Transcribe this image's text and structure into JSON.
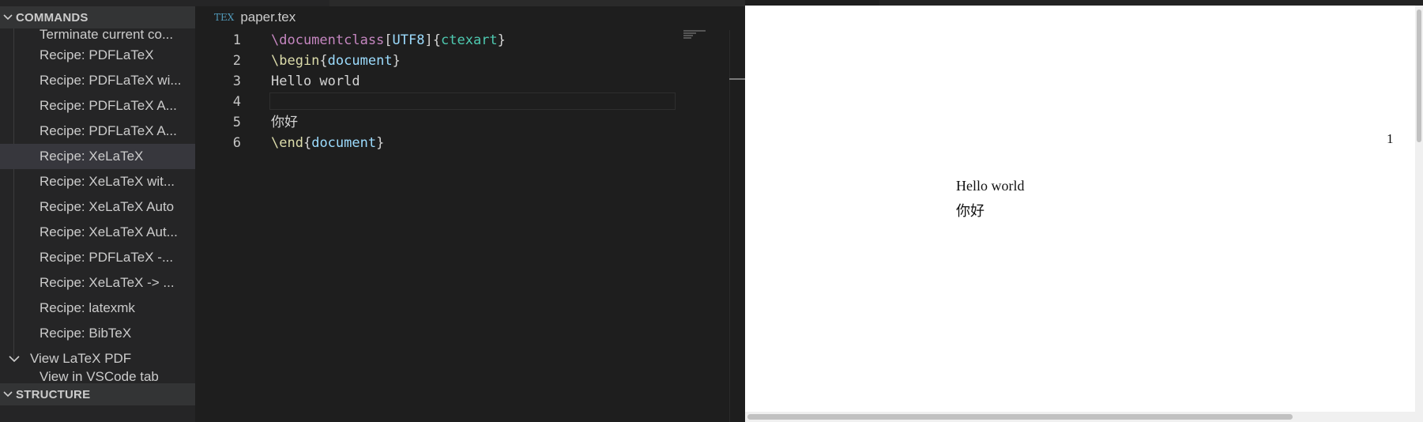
{
  "sidebar": {
    "commands_header": "COMMANDS",
    "structure_header": "STRUCTURE",
    "items": [
      {
        "label": "Terminate current co..."
      },
      {
        "label": "Recipe: PDFLaTeX"
      },
      {
        "label": "Recipe: PDFLaTeX wi..."
      },
      {
        "label": "Recipe: PDFLaTeX A..."
      },
      {
        "label": "Recipe: PDFLaTeX A..."
      },
      {
        "label": "Recipe: XeLaTeX"
      },
      {
        "label": "Recipe: XeLaTeX wit..."
      },
      {
        "label": "Recipe: XeLaTeX Auto"
      },
      {
        "label": "Recipe: XeLaTeX Aut..."
      },
      {
        "label": "Recipe: PDFLaTeX -..."
      },
      {
        "label": "Recipe: XeLaTeX -> ..."
      },
      {
        "label": "Recipe: latexmk"
      },
      {
        "label": "Recipe: BibTeX"
      }
    ],
    "group_label": "View LaTeX PDF",
    "cut_label": "View in VSCode tab"
  },
  "editor": {
    "tab": {
      "icon": "TEX",
      "label": "paper.tex"
    },
    "line_numbers": [
      "1",
      "2",
      "3",
      "4",
      "5",
      "6"
    ],
    "lines": {
      "l1": {
        "cmd": "\\documentclass",
        "ob": "[",
        "opt": "UTF8",
        "cb": "]",
        "oc": "{",
        "arg": "ctexart",
        "cc": "}"
      },
      "l2": {
        "cmd": "\\begin",
        "oc": "{",
        "env": "document",
        "cc": "}"
      },
      "l3": "Hello world",
      "l4": "",
      "l5": "你好",
      "l6": {
        "cmd": "\\end",
        "oc": "{",
        "env": "document",
        "cc": "}"
      }
    }
  },
  "pdf": {
    "page_number": "1",
    "lines": [
      "Hello world",
      "你好"
    ]
  },
  "colors": {
    "command": "#c586c0",
    "begin_end": "#dcdcaa",
    "option": "#9cdcfe",
    "argument": "#4ec9b0",
    "tex_icon": "#519aba"
  }
}
